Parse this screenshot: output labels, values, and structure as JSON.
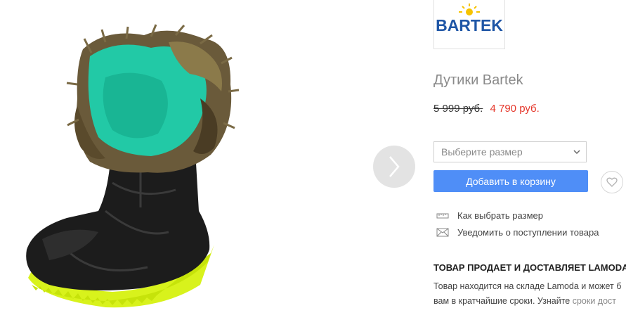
{
  "brand": {
    "name": "BARTEK"
  },
  "product": {
    "title": "Дутики Bartek",
    "old_price": "5 999 руб.",
    "new_price": "4 790 руб."
  },
  "size_select": {
    "placeholder": "Выберите размер"
  },
  "buttons": {
    "add_to_cart": "Добавить в корзину"
  },
  "links": {
    "size_guide": "Как выбрать размер",
    "notify": "Уведомить о поступлении товара"
  },
  "seller": {
    "heading": "ТОВАР ПРОДАЕТ И ДОСТАВЛЯЕТ LAMODA",
    "line1": "Товар находится на складе Lamoda и может б",
    "line2_text": "вам в кратчайшие сроки. Узнайте ",
    "line2_link": "сроки дост"
  },
  "icons": {
    "next": "chevron-right-icon",
    "wishlist": "heart-icon",
    "ruler": "ruler-icon",
    "mail": "envelope-icon",
    "select": "chevron-down-icon"
  },
  "colors": {
    "accent_button": "#4f8ef7",
    "sale_price": "#e5372b",
    "title_gray": "#8a8a8a",
    "logo_blue": "#1f56a6",
    "logo_sun": "#f6c300"
  }
}
